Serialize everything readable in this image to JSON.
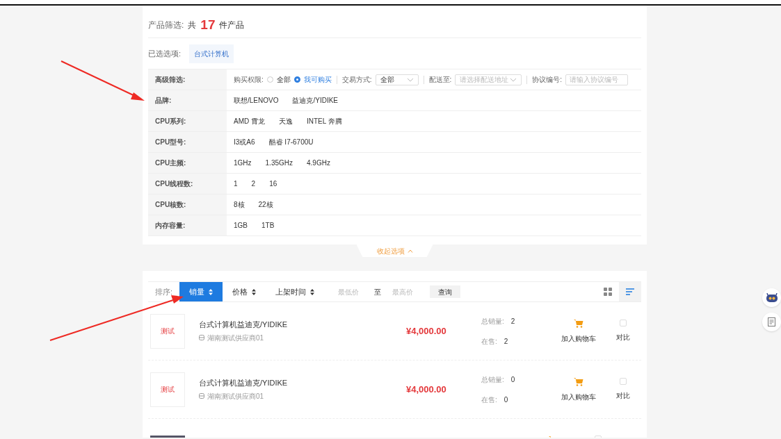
{
  "header": {
    "label": "产品筛选:",
    "prefix": "共",
    "count": "17",
    "suffix": "件产品"
  },
  "selected_options": {
    "label": "已选选项:",
    "tags": [
      "台式计算机"
    ]
  },
  "advanced": {
    "label": "高级筛选:",
    "purchase": {
      "label": "购买权限:",
      "options": [
        {
          "label": "全部",
          "selected": false
        },
        {
          "label": "我可购买",
          "selected": true
        }
      ]
    },
    "trade": {
      "label": "交易方式:",
      "value": "全部"
    },
    "delivery": {
      "label": "配送至:",
      "placeholder": "请选择配送地址"
    },
    "agreement": {
      "label": "协议编号:",
      "placeholder": "请输入协议编号"
    }
  },
  "filters": [
    {
      "label": "品牌:",
      "options": [
        "联想/LENOVO",
        "益迪克/YIDIKE"
      ]
    },
    {
      "label": "CPU系列:",
      "options": [
        "AMD 霄龙",
        "天逸",
        "INTEL 奔腾"
      ]
    },
    {
      "label": "CPU型号:",
      "options": [
        "I3或A6",
        "酷睿 I7-6700U"
      ]
    },
    {
      "label": "CPU主频:",
      "options": [
        "1GHz",
        "1.35GHz",
        "4.9GHz"
      ]
    },
    {
      "label": "CPU线程数:",
      "options": [
        "1",
        "2",
        "16"
      ]
    },
    {
      "label": "CPU核数:",
      "options": [
        "8核",
        "22核"
      ]
    },
    {
      "label": "内存容量:",
      "options": [
        "1GB",
        "1TB"
      ]
    }
  ],
  "collapse": "收起选项",
  "sort": {
    "label": "排序:",
    "options": [
      {
        "label": "销量",
        "selected": true
      },
      {
        "label": "价格",
        "selected": false
      },
      {
        "label": "上架时间",
        "selected": false
      }
    ],
    "min_placeholder": "最低价",
    "to": "至",
    "max_placeholder": "最高价",
    "query": "查询",
    "views": [
      {
        "kind": "grid",
        "selected": false
      },
      {
        "kind": "list",
        "selected": true
      }
    ]
  },
  "products": [
    {
      "kind": "placeholder",
      "image_text": "测试",
      "title": "台式计算机益迪克/YIDIKE",
      "supplier": "湖南测试供应商01",
      "price": "¥4,000.00",
      "total_label": "总销量:",
      "total": "2",
      "stock_label": "在售:",
      "stock": "2",
      "cart": "加入购物车",
      "compare": "对比",
      "compare_checked": false
    },
    {
      "kind": "placeholder",
      "image_text": "测试",
      "title": "台式计算机益迪克/YIDIKE",
      "supplier": "湖南测试供应商01",
      "price": "¥4,000.00",
      "total_label": "总销量:",
      "total": "0",
      "stock_label": "在售:",
      "stock": "0",
      "cart": "加入购物车",
      "compare": "对比",
      "compare_checked": false
    },
    {
      "kind": "photo",
      "compare_checked": false
    }
  ]
}
